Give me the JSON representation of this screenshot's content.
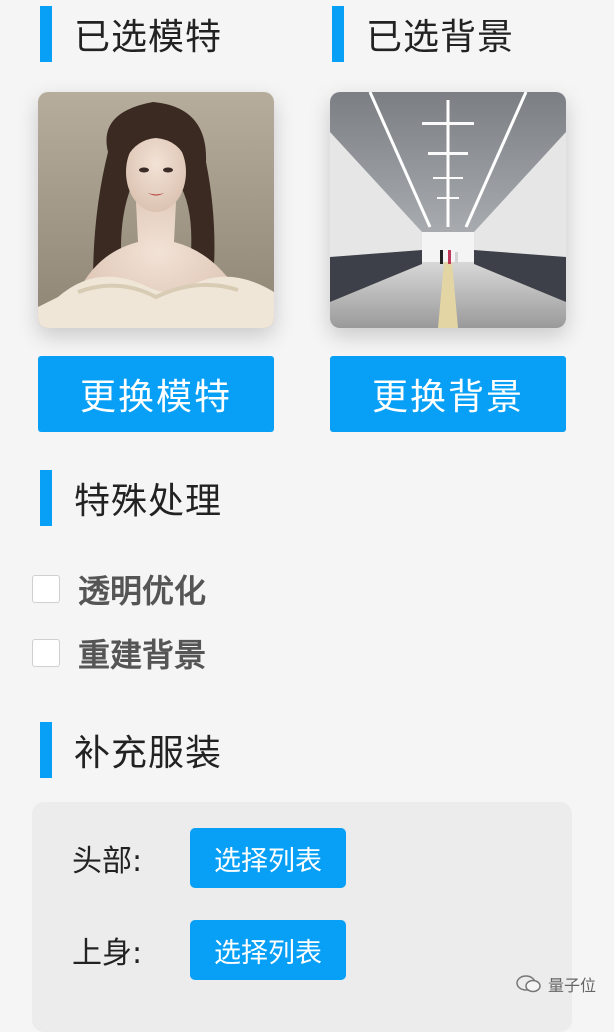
{
  "sections": {
    "model_title": "已选模特",
    "background_title": "已选背景",
    "special_title": "特殊处理",
    "clothing_title": "补充服装"
  },
  "buttons": {
    "change_model": "更换模特",
    "change_background": "更换背景"
  },
  "special_options": [
    {
      "label": "透明优化",
      "checked": false
    },
    {
      "label": "重建背景",
      "checked": false
    }
  ],
  "clothing_rows": [
    {
      "label": "头部:",
      "button": "选择列表"
    },
    {
      "label": "上身:",
      "button": "选择列表"
    }
  ],
  "watermark": "量子位",
  "colors": {
    "accent": "#07a0f6",
    "background": "#f5f5f5",
    "panel": "#ececec"
  }
}
